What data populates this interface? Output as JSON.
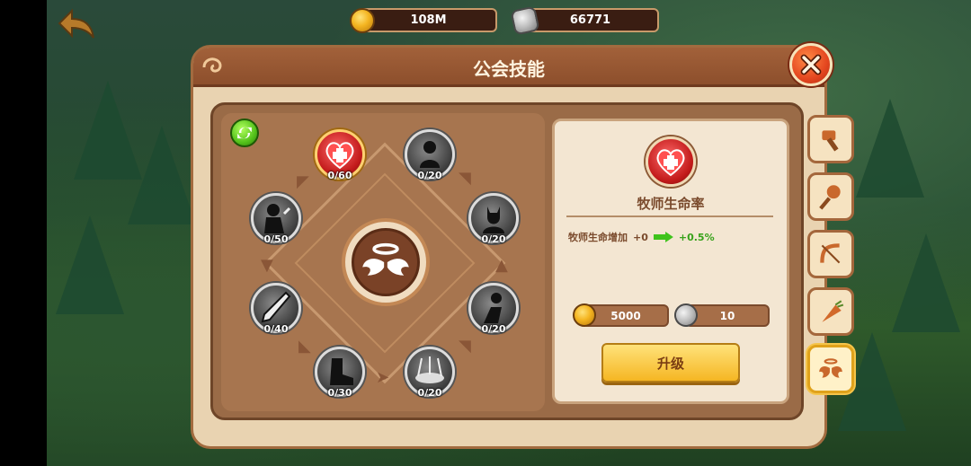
{
  "top_bar": {
    "gold": "108M",
    "stones": "66771",
    "back_icon": "back-arrow-icon",
    "gold_icon": "gold-coin-icon",
    "stone_icon": "stone-icon"
  },
  "panel": {
    "title": "公会技能",
    "close_icon": "close-icon"
  },
  "skills": [
    {
      "name": "priest-health",
      "progress": "0/60",
      "active": true
    },
    {
      "name": "skill-2",
      "progress": "0/20",
      "active": false
    },
    {
      "name": "skill-3",
      "progress": "0/20",
      "active": false
    },
    {
      "name": "skill-4",
      "progress": "0/20",
      "active": false
    },
    {
      "name": "skill-5",
      "progress": "0/20",
      "active": false
    },
    {
      "name": "skill-6",
      "progress": "0/30",
      "active": false
    },
    {
      "name": "skill-7",
      "progress": "0/40",
      "active": false
    },
    {
      "name": "skill-8",
      "progress": "0/50",
      "active": false
    }
  ],
  "detail": {
    "name": "牧师生命率",
    "effect_label": "牧师生命增加",
    "current": "+0",
    "next": "+0.5%",
    "cost_gold": "5000",
    "cost_stone": "10",
    "upgrade_label": "升级"
  },
  "tabs": [
    "tab-hammer",
    "tab-staff",
    "tab-bow",
    "tab-carrot",
    "tab-wings"
  ],
  "colors": {
    "panel_bg": "#e9d3b1",
    "header": "#8d4f2c",
    "upgrade": "#f5b623",
    "active_skill": "#c21a1a"
  }
}
